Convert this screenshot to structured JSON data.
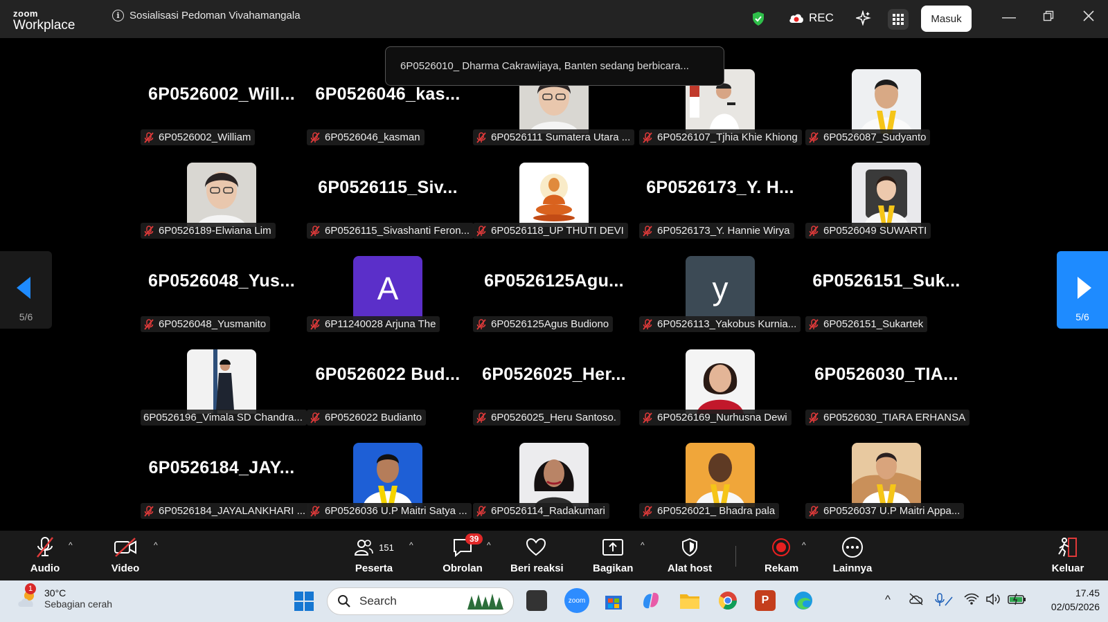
{
  "titlebar": {
    "brand_top": "zoom",
    "brand_bottom": "Workplace",
    "meeting_title": "Sosialisasi Pedoman Vivahamangala",
    "rec_label": "REC",
    "signin_label": "Masuk"
  },
  "toast": "6P0526010_ Dharma Cakrawijaya, Banten sedang berbicara...",
  "gallery": {
    "tiles": [
      {
        "big": "6P0526002_Will...",
        "label": "6P0526002_William",
        "pic": null
      },
      {
        "big": "6P0526046_kas...",
        "label": "6P0526046_kasman",
        "pic": null
      },
      {
        "big": null,
        "label": "6P0526111 Sumatera Utara ...",
        "pic": "photo-woman-glasses"
      },
      {
        "big": null,
        "label": "6P0526107_Tjhia Khie Khiong",
        "pic": "photo-speaker"
      },
      {
        "big": null,
        "label": "6P0526087_Sudyanto",
        "pic": "photo-man-yellow-scarf"
      },
      {
        "big": null,
        "label": "6P0526189-Elwiana Lim",
        "pic": "photo-woman-glasses"
      },
      {
        "big": "6P0526115_Siv...",
        "label": "6P0526115_Sivashanti Feron...",
        "pic": null
      },
      {
        "big": null,
        "label": "6P0526118_UP THUTI DEVI",
        "pic": "buddha-image"
      },
      {
        "big": "6P0526173_Y. H...",
        "label": "6P0526173_Y. Hannie Wirya",
        "pic": null
      },
      {
        "big": null,
        "label": "6P0526049 SUWARTI",
        "pic": "photo-woman-yellow-scarf"
      },
      {
        "big": "6P0526048_Yus...",
        "label": "6P0526048_Yusmanito",
        "pic": null
      },
      {
        "big": null,
        "label": "6P11240028 Arjuna The",
        "pic": "letter",
        "letter": "A",
        "color": "#5b2fc9"
      },
      {
        "big": "6P0526125Agu...",
        "label": "6P0526125Agus Budiono",
        "pic": null
      },
      {
        "big": null,
        "label": "6P0526113_Yakobus Kurnia...",
        "pic": "letter",
        "letter": "y",
        "color": "#3c4a55"
      },
      {
        "big": "6P0526151_Suk...",
        "label": "6P0526151_Sukartek",
        "pic": null
      },
      {
        "big": null,
        "label": "6P0526196_Vimala SD Chandra...",
        "pic": "photo-woman-standing",
        "nomic": true
      },
      {
        "big": "6P0526022  Bud...",
        "label": "6P0526022 Budianto",
        "pic": null
      },
      {
        "big": "6P0526025_Her...",
        "label": "6P0526025_Heru Santoso.",
        "pic": null
      },
      {
        "big": null,
        "label": "6P0526169_Nurhusna Dewi",
        "pic": "photo-woman-red"
      },
      {
        "big": "6P0526030_TIA...",
        "label": "6P0526030_TIARA ERHANSA",
        "pic": null
      },
      {
        "big": "6P0526184_JAY...",
        "label": "6P0526184_JAYALANKHARI ...",
        "pic": null
      },
      {
        "big": null,
        "label": "6P0526036 U.P Maitri Satya ...",
        "pic": "photo-man-blue-bg"
      },
      {
        "big": null,
        "label": "6P0526114_Radakumari",
        "pic": "photo-woman-dark-hair"
      },
      {
        "big": null,
        "label": "6P0526021_ Bhadra pala",
        "pic": "photo-man-orange-bg"
      },
      {
        "big": null,
        "label": "6P0526037 U.P Maitri Appa...",
        "pic": "photo-man-illustrated"
      }
    ]
  },
  "nav": {
    "left_page": "5/6",
    "right_page": "5/6"
  },
  "controls": {
    "audio": "Audio",
    "video": "Video",
    "participants": "Peserta",
    "participants_count": "151",
    "chat": "Obrolan",
    "chat_badge": "39",
    "react": "Beri reaksi",
    "share": "Bagikan",
    "host_tools": "Alat host",
    "record": "Rekam",
    "more": "Lainnya",
    "leave": "Keluar"
  },
  "taskbar": {
    "weather_badge": "1",
    "temperature": "30°C",
    "weather_desc": "Sebagian cerah",
    "search_placeholder": "Search",
    "time": "17.45",
    "date": "02/05/2026"
  },
  "colors": {
    "accent": "#1e8bff",
    "mute_red": "#e03a3a",
    "rec_red": "#e82020"
  }
}
